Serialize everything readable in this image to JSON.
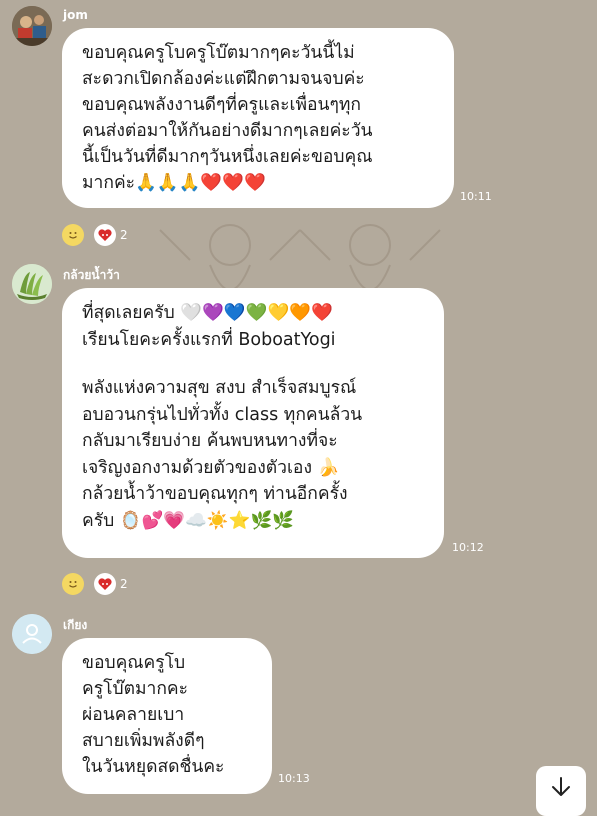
{
  "messages": [
    {
      "sender": "jom",
      "avatar_icon": "photo-avatar-icon",
      "lines": [
        "ขอบคุณครูโบครูโบ๊ตมากๆคะวันนี้ไม่",
        "สะดวกเปิดกล้องค่ะแต่ฝึกตามจนจบค่ะ",
        "ขอบคุณพลังงานดีๆที่ครูและเพื่อนๆทุก",
        "คนส่งต่อมาให้กันอย่างดีมากๆเลยค่ะวัน",
        "นี้เป็นวันที่ดีมากๆวันหนึ่งเลยค่ะขอบคุณ",
        "มากค่ะ🙏🙏🙏❤️❤️❤️"
      ],
      "time": "10:11",
      "reaction_count": "2"
    },
    {
      "sender": "กล้วยน้ำว้า",
      "avatar_icon": "banana-avatar-icon",
      "lines": [
        "ที่สุดเลยครับ 🤍💜💙💚💛🧡❤️",
        "เรียนโยคะครั้งแรกที่  BoboatYogi",
        "",
        "พลังแห่งความสุข สงบ สำเร็จสมบูรณ์",
        "อบอวนกรุ่นไปทั่วทั้ง class ทุกคนล้วน",
        "กลับมาเรียบง่าย ค้นพบหนทางที่จะ",
        "เจริญงอกงามด้วยตัวของตัวเอง 🍌",
        "กล้วยน้ำว้าขอบคุณทุกๆ ท่านอีกครั้ง",
        "ครับ 🪞💕💗☁️☀️⭐🌿🌿"
      ],
      "time": "10:12",
      "reaction_count": "2"
    },
    {
      "sender": "เกียง",
      "avatar_icon": "default-user-avatar-icon",
      "lines": [
        "ขอบคุณครูโบ",
        "ครูโบ๊ตมากคะ",
        "ผ่อนคลายเบา",
        "สบายเพิ่มพลังดีๆ",
        "ในวันหยุดสดชื่นคะ"
      ],
      "time": "10:13"
    }
  ],
  "icons": {
    "reaction_smile": "smile-reaction-icon",
    "reaction_heart": "heart-reaction-icon",
    "scroll_down": "arrow-down-icon"
  },
  "colors": {
    "chat_background": "#b3aa9c",
    "bubble": "#ffffff",
    "meta_text": "#ffffff"
  }
}
